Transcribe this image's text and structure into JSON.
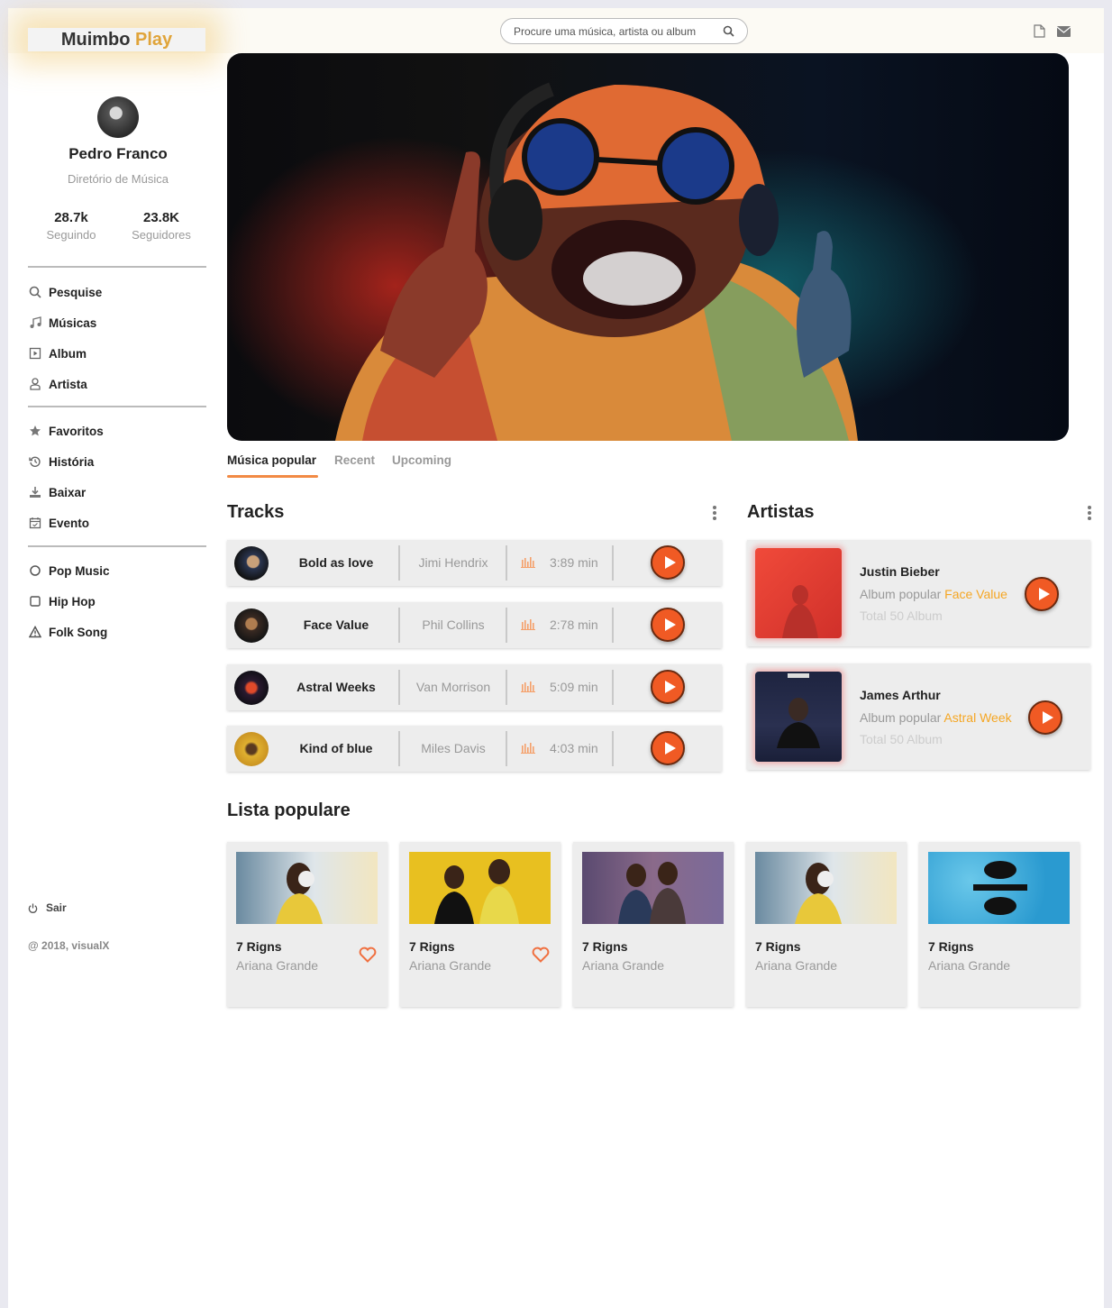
{
  "app": {
    "logo_part1": "Muimbo",
    "logo_part2": "Play"
  },
  "search": {
    "placeholder": "Procure uma música, artista ou album"
  },
  "header": {
    "icons": [
      "document-icon",
      "mail-icon"
    ]
  },
  "profile": {
    "name": "Pedro Franco",
    "role": "Diretório de Música",
    "following_count": "28.7k",
    "following_label": "Seguindo",
    "followers_count": "23.8K",
    "followers_label": "Seguidores"
  },
  "sidebar": {
    "group1": [
      {
        "label": "Pesquise",
        "icon": "search-icon"
      },
      {
        "label": "Músicas",
        "icon": "music-note-icon"
      },
      {
        "label": "Album",
        "icon": "album-icon"
      },
      {
        "label": "Artista",
        "icon": "user-icon"
      }
    ],
    "group2": [
      {
        "label": "Favoritos",
        "icon": "star-icon"
      },
      {
        "label": "História",
        "icon": "history-icon"
      },
      {
        "label": "Baixar",
        "icon": "download-icon"
      },
      {
        "label": "Evento",
        "icon": "calendar-icon"
      }
    ],
    "group3": [
      {
        "label": "Pop Music",
        "icon": "circle-icon"
      },
      {
        "label": "Hip Hop",
        "icon": "square-icon"
      },
      {
        "label": "Folk Song",
        "icon": "triangle-icon"
      }
    ],
    "logout": "Sair",
    "copyright": "@ 2018, visualX"
  },
  "tabs": [
    {
      "label": "Música popular",
      "active": true
    },
    {
      "label": "Recent",
      "active": false
    },
    {
      "label": "Upcoming",
      "active": false
    }
  ],
  "tracks": {
    "title": "Tracks",
    "items": [
      {
        "name": "Bold as love",
        "artist": "Jimi Hendrix",
        "duration": "3:89 min"
      },
      {
        "name": "Face Value",
        "artist": "Phil Collins",
        "duration": "2:78 min"
      },
      {
        "name": "Astral Weeks",
        "artist": "Van Morrison",
        "duration": "5:09 min"
      },
      {
        "name": "Kind of blue",
        "artist": "Miles Davis",
        "duration": "4:03 min"
      }
    ]
  },
  "artists": {
    "title": "Artistas",
    "items": [
      {
        "name": "Justin Bieber",
        "popular_prefix": "Album popular",
        "popular_album": "Face Value",
        "total": "Total 50 Album"
      },
      {
        "name": "James Arthur",
        "popular_prefix": "Album popular",
        "popular_album": "Astral Week",
        "total": "Total 50 Album"
      }
    ]
  },
  "lista": {
    "title": "Lista populare",
    "items": [
      {
        "title": "7 Rigns",
        "artist": "Ariana Grande",
        "favorite": true
      },
      {
        "title": "7 Rigns",
        "artist": "Ariana Grande",
        "favorite": true
      },
      {
        "title": "7 Rigns",
        "artist": "Ariana Grande",
        "favorite": false
      },
      {
        "title": "7 Rigns",
        "artist": "Ariana Grande",
        "favorite": false
      },
      {
        "title": "7 Rigns",
        "artist": "Ariana Grande",
        "favorite": false
      }
    ]
  },
  "colors": {
    "accent": "#f05a24",
    "highlight": "#f5a623",
    "logo_accent": "#e0a43a"
  }
}
